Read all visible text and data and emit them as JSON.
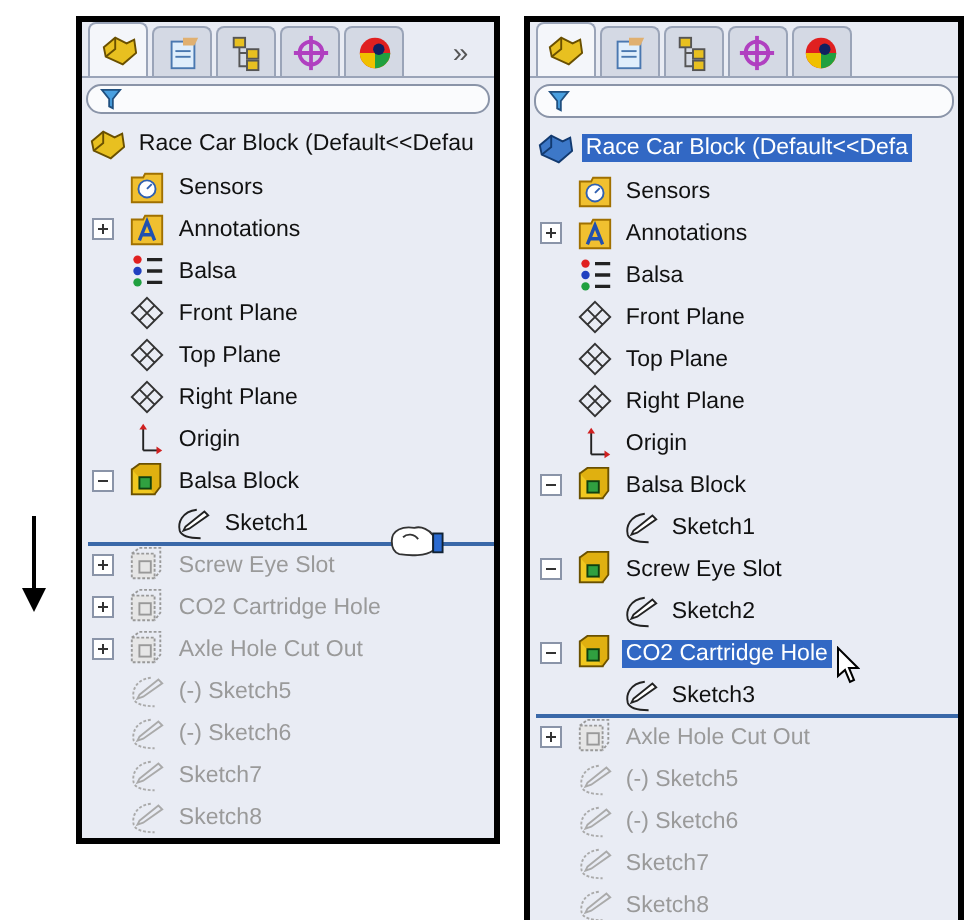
{
  "panels": [
    {
      "tabs": [
        {
          "kind": "part",
          "selected": true
        },
        {
          "kind": "property",
          "selected": false
        },
        {
          "kind": "config",
          "selected": false
        },
        {
          "kind": "target",
          "selected": false
        },
        {
          "kind": "appearance",
          "selected": false
        }
      ],
      "more": "»",
      "tree": {
        "label": "Race Car Block (Default<<Defau",
        "kind": "part",
        "selected": false,
        "children": [
          {
            "label": "Sensors",
            "kind": "sensors"
          },
          {
            "label": "Annotations",
            "kind": "annotations",
            "expanded": false
          },
          {
            "label": "Balsa",
            "kind": "material"
          },
          {
            "label": "Front Plane",
            "kind": "plane"
          },
          {
            "label": "Top Plane",
            "kind": "plane"
          },
          {
            "label": "Right Plane",
            "kind": "plane"
          },
          {
            "label": "Origin",
            "kind": "origin"
          },
          {
            "label": "Balsa Block",
            "kind": "feature",
            "expanded": true,
            "children": [
              {
                "label": "Sketch1",
                "kind": "sketch"
              }
            ]
          },
          {
            "kind": "rollback",
            "grabbed": true
          },
          {
            "label": "Screw Eye Slot",
            "kind": "feature",
            "expanded": false,
            "rolled_back": true
          },
          {
            "label": "CO2 Cartridge Hole",
            "kind": "feature",
            "expanded": false,
            "rolled_back": true
          },
          {
            "label": "Axle Hole Cut Out",
            "kind": "feature",
            "expanded": false,
            "rolled_back": true
          },
          {
            "label": "(-) Sketch5",
            "kind": "sketch",
            "rolled_back": true
          },
          {
            "label": "(-) Sketch6",
            "kind": "sketch",
            "rolled_back": true
          },
          {
            "label": "Sketch7",
            "kind": "sketch",
            "rolled_back": true
          },
          {
            "label": "Sketch8",
            "kind": "sketch",
            "rolled_back": true
          }
        ]
      }
    },
    {
      "tabs": [
        {
          "kind": "part",
          "selected": true
        },
        {
          "kind": "property",
          "selected": false
        },
        {
          "kind": "config",
          "selected": false
        },
        {
          "kind": "target",
          "selected": false
        },
        {
          "kind": "appearance",
          "selected": false
        }
      ],
      "tree": {
        "label": "Race Car Block (Default<<Defa",
        "kind": "part",
        "selected": true,
        "children": [
          {
            "label": "Sensors",
            "kind": "sensors"
          },
          {
            "label": "Annotations",
            "kind": "annotations",
            "expanded": false
          },
          {
            "label": "Balsa",
            "kind": "material"
          },
          {
            "label": "Front Plane",
            "kind": "plane"
          },
          {
            "label": "Top Plane",
            "kind": "plane"
          },
          {
            "label": "Right Plane",
            "kind": "plane"
          },
          {
            "label": "Origin",
            "kind": "origin"
          },
          {
            "label": "Balsa Block",
            "kind": "feature",
            "expanded": true,
            "children": [
              {
                "label": "Sketch1",
                "kind": "sketch"
              }
            ]
          },
          {
            "label": "Screw Eye Slot",
            "kind": "feature",
            "expanded": true,
            "children": [
              {
                "label": "Sketch2",
                "kind": "sketch"
              }
            ]
          },
          {
            "label": "CO2 Cartridge Hole",
            "kind": "feature",
            "expanded": true,
            "selected": true,
            "hovered": true,
            "children": [
              {
                "label": "Sketch3",
                "kind": "sketch"
              }
            ]
          },
          {
            "kind": "rollback"
          },
          {
            "label": "Axle Hole Cut Out",
            "kind": "feature",
            "expanded": false,
            "rolled_back": true
          },
          {
            "label": "(-) Sketch5",
            "kind": "sketch",
            "rolled_back": true
          },
          {
            "label": "(-) Sketch6",
            "kind": "sketch",
            "rolled_back": true
          },
          {
            "label": "Sketch7",
            "kind": "sketch",
            "rolled_back": true
          },
          {
            "label": "Sketch8",
            "kind": "sketch",
            "rolled_back": true
          }
        ]
      }
    }
  ]
}
